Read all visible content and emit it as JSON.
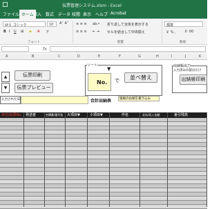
{
  "app": {
    "title": "伝票管理システム.xlsm - Excel"
  },
  "tabs": [
    "ファイル",
    "ホーム",
    "挿入",
    "数式",
    "データ",
    "校閲",
    "表示",
    "ヘルプ",
    "Acrobat"
  ],
  "ribbon": {
    "font_name": "ＭＳ ゴシック",
    "font_size": "10",
    "font_group_label": "フォント",
    "wrap_text": "折り返して全体を表示する",
    "merge_center": "セルを結合して中央揃え",
    "number_format": "標準",
    "align_group_label": "配置",
    "number_group_label": "数値"
  },
  "formula_bar": {
    "fx": "fx",
    "name_box": ""
  },
  "columns": [
    "A",
    "B",
    "C",
    "D",
    "E",
    "F",
    "G",
    "H",
    "I",
    "J",
    "K"
  ],
  "sheet": {
    "print_button": "伝票印刷",
    "preview_button": "伝票プレビュー",
    "sort_group_label": "ソート",
    "sort_no_label": "No.",
    "sort_de": "で",
    "sort_button": "並べ替え",
    "output_group_label": "出納帳出力",
    "output_hint": "入力済みの部分だけ",
    "output_button": "出納帳印刷",
    "date_label": "入力された日付",
    "total_label": "合計出納表",
    "total_note": "縦線の右端を書き込み",
    "headers": [
      "日付/伝票No.",
      "発送者",
      "空欄番/番号各",
      "大項目▼",
      "小項目▼",
      "件名",
      "支払/収入金額",
      "差引残高"
    ]
  },
  "colors": {
    "excel_green": "#217346",
    "header_dark": "#1f1f1f",
    "input_yellow": "#fffbc7"
  }
}
